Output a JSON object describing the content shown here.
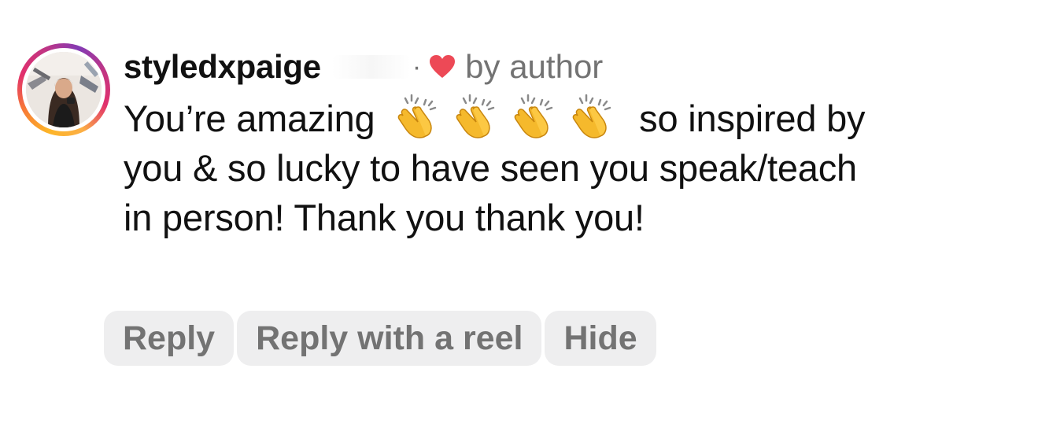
{
  "comment": {
    "username": "styledxpaige",
    "separator": "·",
    "liked_by_author_label": "by author",
    "text_before_emoji": "You’re amazing",
    "emoji_icon": "clapping-hands-icon",
    "emoji_count": 4,
    "text_after_emoji": "so inspired by you & so lucky to have seen you speak/teach in person! Thank you thank you!"
  },
  "actions": {
    "reply_label": "Reply",
    "reply_with_reel_label": "Reply with a reel",
    "hide_label": "Hide"
  },
  "colors": {
    "heart": "#ed4956",
    "secondary_text": "#737373",
    "button_bg": "#eeeeef"
  }
}
